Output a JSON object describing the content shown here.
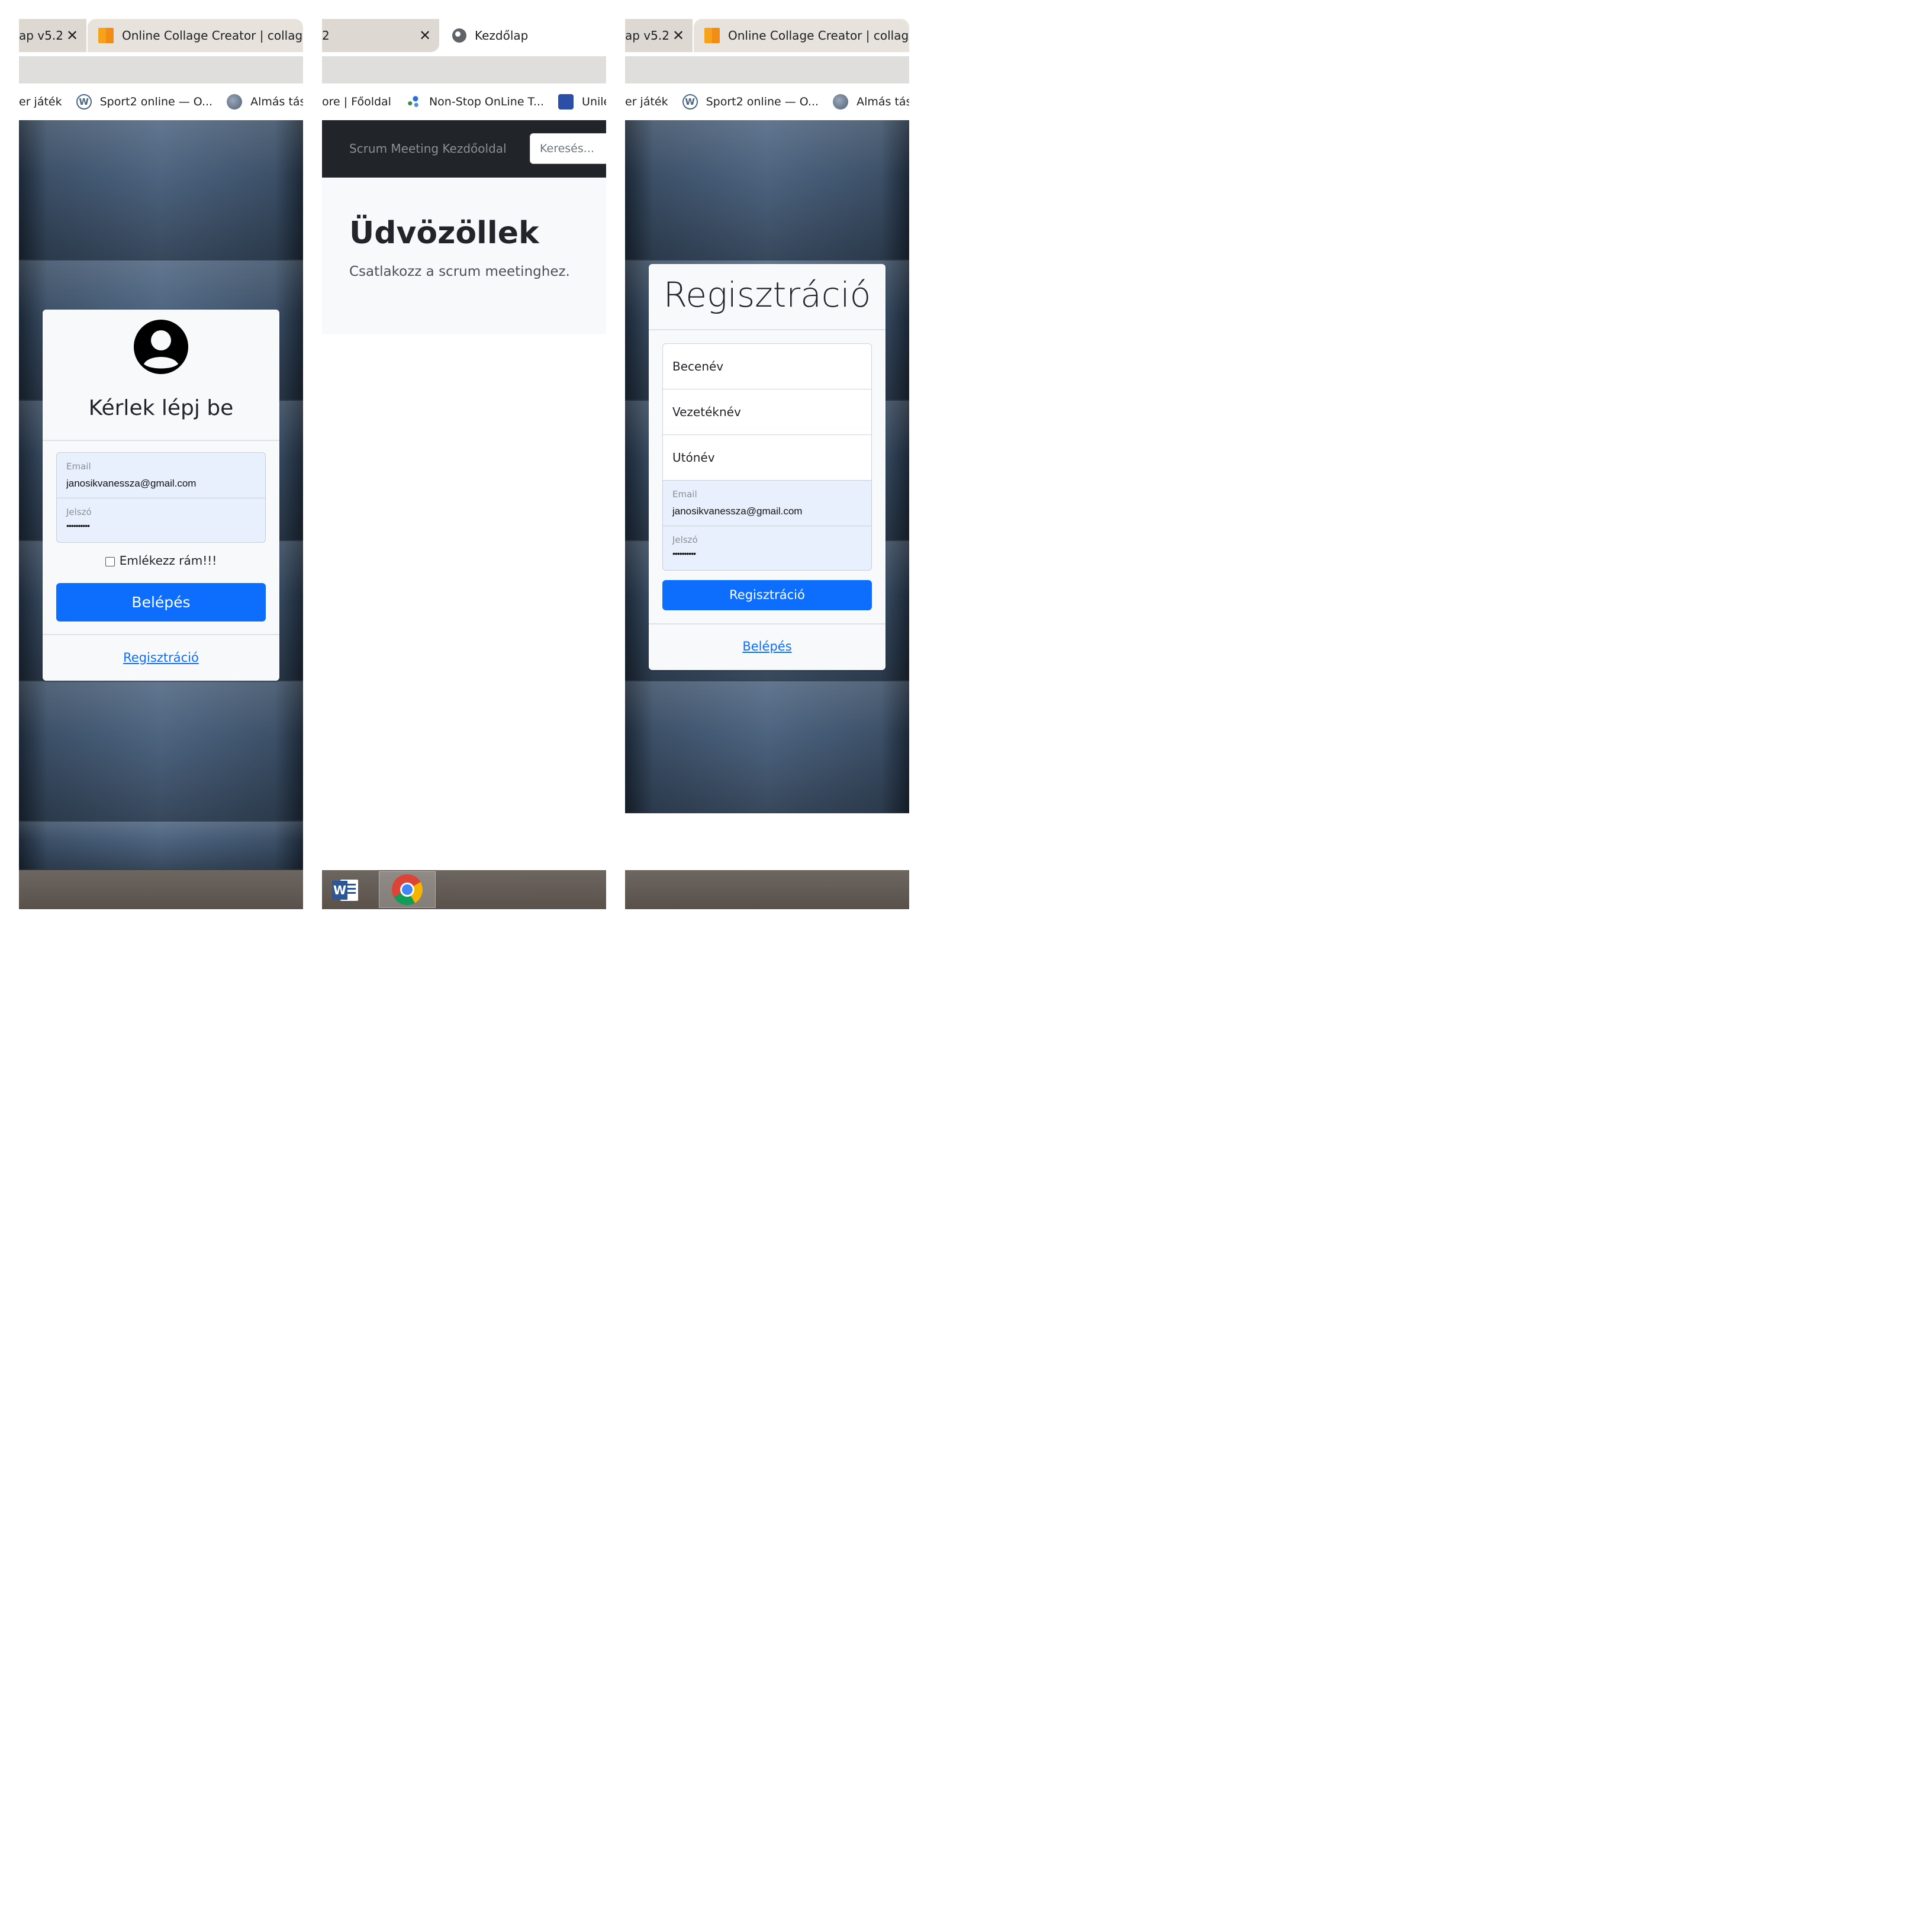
{
  "login_panel": {
    "tabs": [
      {
        "label": "ap v5.2"
      },
      {
        "label": "Online Collage Creator | collage-"
      }
    ],
    "bookmarks": [
      {
        "label": "er játék"
      },
      {
        "label": "Sport2 online — O..."
      },
      {
        "label": "Almás táska"
      }
    ],
    "card": {
      "title": "Kérlek lépj be",
      "email_label": "Email",
      "email_value": "janosikvanessza@gmail.com",
      "password_label": "Jelszó",
      "password_value": "••••••••••",
      "remember_label": "Emlékezz rám!!!",
      "submit_label": "Belépés",
      "register_link": "Regisztráció"
    }
  },
  "home_panel": {
    "tabs": [
      {
        "label": "2"
      },
      {
        "label": "Kezdőlap"
      }
    ],
    "bookmarks": [
      {
        "label": "ore | Főoldal"
      },
      {
        "label": "Non-Stop OnLine T..."
      },
      {
        "label": "Unilev"
      }
    ],
    "navbar": {
      "brand": "Scrum Meeting Kezdőoldal",
      "search_placeholder": "Keresés..."
    },
    "hero": {
      "title": "Üdvözöllek",
      "subtitle": "Csatlakozz a scrum meetinghez."
    },
    "taskbar": [
      {
        "icon": "word-icon",
        "label": "W"
      },
      {
        "icon": "chrome-icon"
      }
    ]
  },
  "register_panel": {
    "tabs": [
      {
        "label": "ap v5.2"
      },
      {
        "label": "Online Collage Creator | collage-"
      }
    ],
    "bookmarks": [
      {
        "label": "er játék"
      },
      {
        "label": "Sport2 online — O..."
      },
      {
        "label": "Almás táska"
      }
    ],
    "card": {
      "title": "Regisztráció",
      "nickname_placeholder": "Becenév",
      "lastname_placeholder": "Vezetéknév",
      "firstname_placeholder": "Utónév",
      "email_label": "Email",
      "email_value": "janosikvanessza@gmail.com",
      "password_label": "Jelszó",
      "password_value": "••••••••••",
      "submit_label": "Regisztráció",
      "login_link": "Belépés"
    }
  },
  "colors": {
    "primary": "#0d6efd",
    "navbar": "#212529",
    "card": "#f8f9fa",
    "autofill": "#e8f0fe"
  }
}
